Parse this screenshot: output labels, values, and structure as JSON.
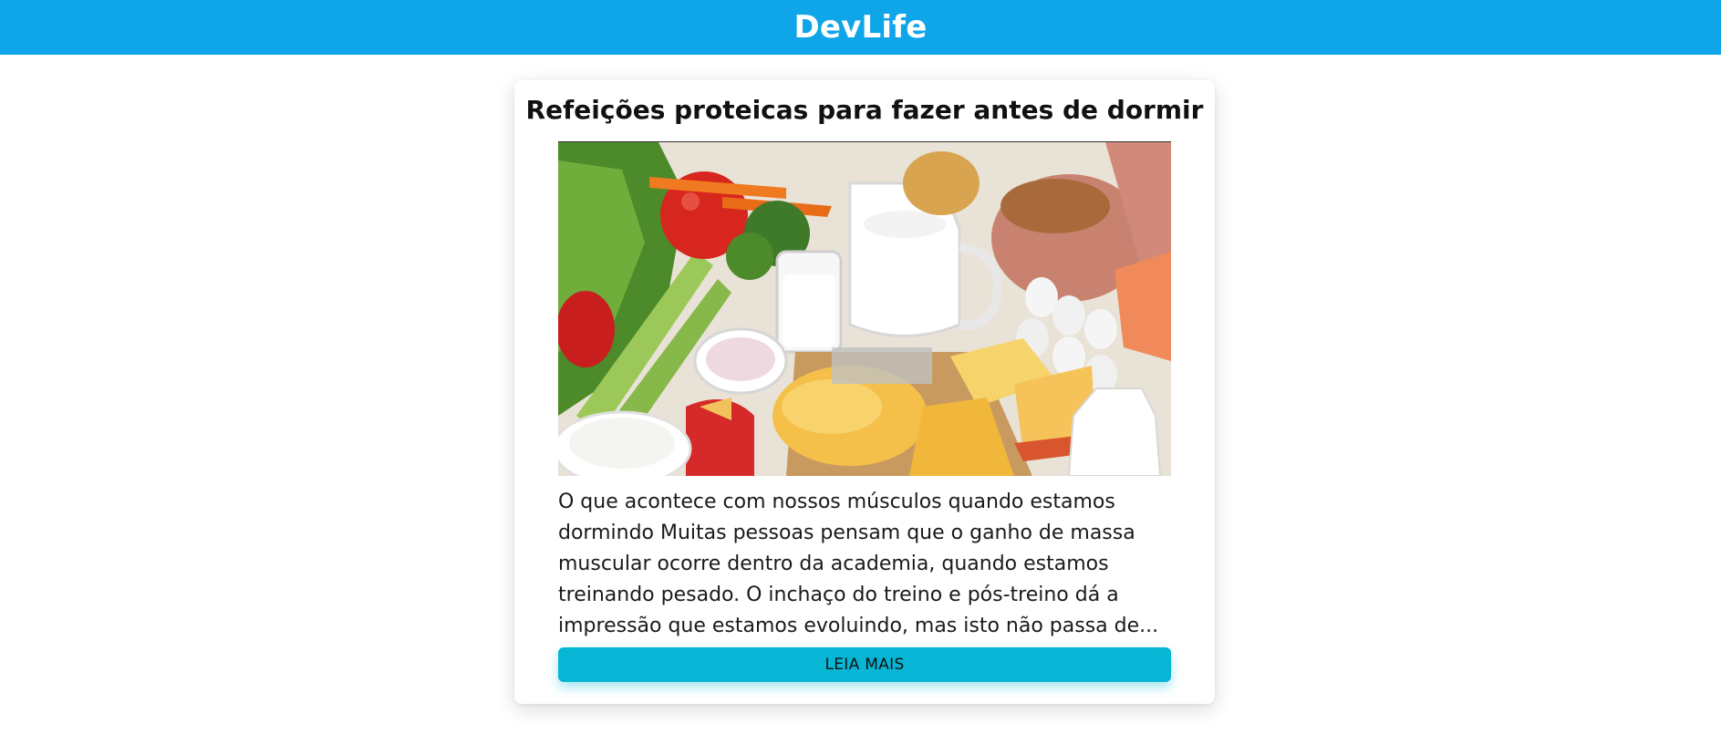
{
  "header": {
    "brand": "DevLife",
    "background": "#0ea5e9"
  },
  "post": {
    "title": "Refeições proteicas para fazer antes de dormir",
    "image_alt": "Foods: vegetables, milk, cheese, eggs, ham",
    "excerpt": "O que acontece com nossos músculos quando estamos dormindo Muitas pessoas pensam que o ganho de massa muscular ocorre dentro da academia, quando estamos treinando pesado. O inchaço do treino e pós-treino dá a impressão que estamos evoluindo, mas isto não passa de...",
    "read_more_label": "LEIA MAIS",
    "button_color": "#06b6d4"
  }
}
